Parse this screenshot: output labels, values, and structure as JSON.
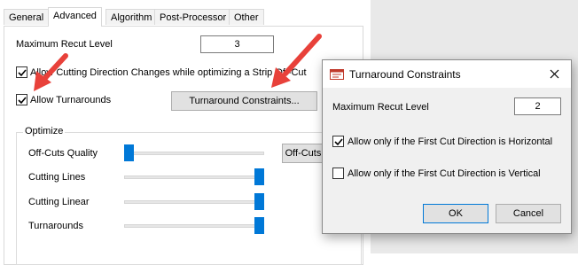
{
  "tabs": [
    {
      "label": "General"
    },
    {
      "label": "Advanced"
    },
    {
      "label": "Algorithm"
    },
    {
      "label": "Post-Processor"
    },
    {
      "label": "Other"
    }
  ],
  "active_tab": "Advanced",
  "advanced": {
    "max_recut_label": "Maximum Recut Level",
    "max_recut_value": "3",
    "allow_direction_changes_label": "Allow Cutting Direction Changes while optimizing a Strip Off-Cut",
    "allow_direction_changes_checked": true,
    "allow_turnarounds_label": "Allow Turnarounds",
    "allow_turnarounds_checked": true,
    "turnaround_constraints_button": "Turnaround Constraints..."
  },
  "optimize": {
    "group_label": "Optimize",
    "sliders": [
      {
        "label": "Off-Cuts Quality",
        "level": 0.0
      },
      {
        "label": "Cutting Lines",
        "level": 1.0
      },
      {
        "label": "Cutting Linear",
        "level": 1.0
      },
      {
        "label": "Turnarounds",
        "level": 1.0
      }
    ],
    "offcuts_button": "Off-Cuts"
  },
  "dialog": {
    "title": "Turnaround Constraints",
    "icon": "dialog-app-icon",
    "close_icon": "close-icon",
    "max_recut_label": "Maximum Recut Level",
    "max_recut_value": "2",
    "only_horizontal_label": "Allow only if the First Cut Direction is Horizontal",
    "only_horizontal_checked": true,
    "only_vertical_label": "Allow only if the First Cut Direction is Vertical",
    "only_vertical_checked": false,
    "ok_label": "OK",
    "cancel_label": "Cancel"
  },
  "colors": {
    "accent": "#0078d7",
    "annotation_arrow": "#e8413a",
    "dialog_body": "#f0f0f0"
  }
}
